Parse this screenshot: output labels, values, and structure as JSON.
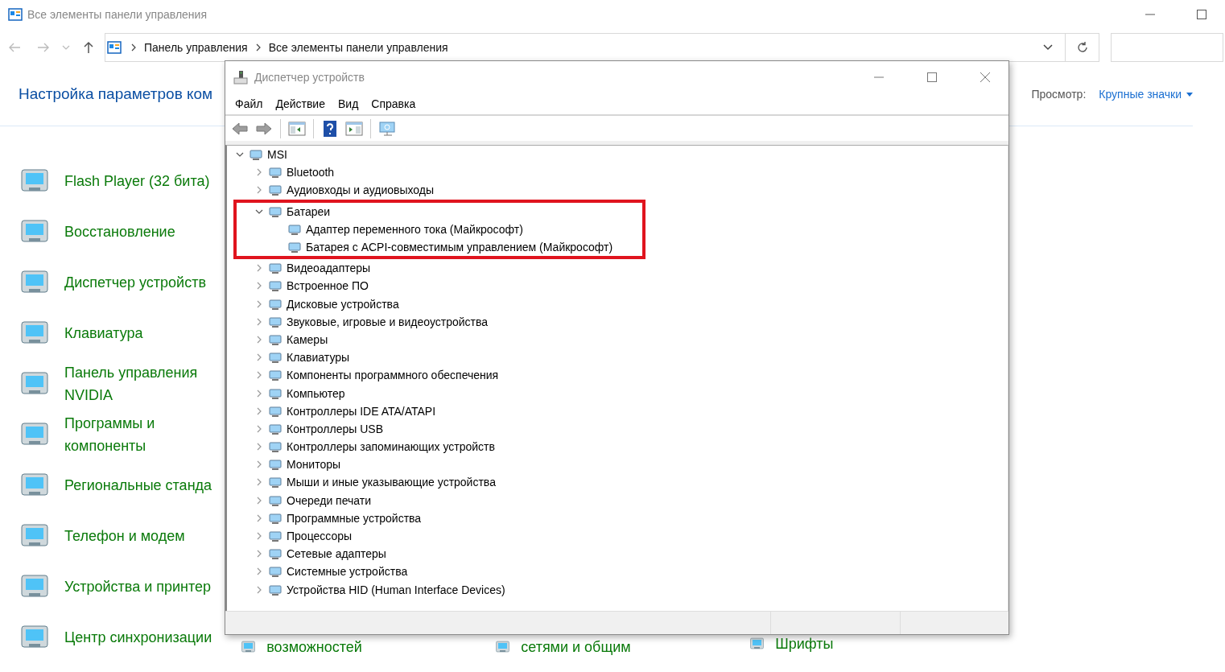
{
  "window": {
    "title": "Все элементы панели управления"
  },
  "address_bar": {
    "breadcrumbs": [
      "Панель управления",
      "Все элементы панели управления"
    ]
  },
  "heading": "Настройка параметров ком",
  "view": {
    "label": "Просмотр:",
    "value": "Крупные значки"
  },
  "applets": [
    {
      "label": "Flash Player (32 бита)"
    },
    {
      "label": "Восстановление"
    },
    {
      "label": "Диспетчер устройств"
    },
    {
      "label": "Клавиатура"
    },
    {
      "label": "Панель управления NVIDIA"
    },
    {
      "label": "Программы и компоненты"
    },
    {
      "label": "Региональные станда"
    },
    {
      "label": "Телефон и модем"
    },
    {
      "label": "Устройства и принтер"
    },
    {
      "label": "Центр синхронизации"
    }
  ],
  "bottom_applets": [
    {
      "label": "возможностей"
    },
    {
      "label": "сетями и общим"
    },
    {
      "label": "Шрифты"
    }
  ],
  "device_manager": {
    "title": "Диспетчер устройств",
    "menu": [
      "Файл",
      "Действие",
      "Вид",
      "Справка"
    ],
    "tree": [
      {
        "label": "MSI",
        "expanded": true,
        "highlighted": false,
        "children": [
          {
            "label": "Bluetooth",
            "expanded": false,
            "highlighted": false
          },
          {
            "label": "Аудиовходы и аудиовыходы",
            "expanded": false,
            "highlighted": false
          },
          {
            "label": "Батареи",
            "expanded": true,
            "highlighted": true,
            "children": [
              {
                "label": "Адаптер переменного тока (Майкрософт)",
                "highlighted": false
              },
              {
                "label": "Батарея с ACPI-совместимым управлением (Майкрософт)",
                "highlighted": false
              }
            ]
          },
          {
            "label": "Видеоадаптеры",
            "expanded": false,
            "highlighted": false
          },
          {
            "label": "Встроенное ПО",
            "expanded": false,
            "highlighted": false
          },
          {
            "label": "Дисковые устройства",
            "expanded": false,
            "highlighted": false
          },
          {
            "label": "Звуковые, игровые и видеоустройства",
            "expanded": false,
            "highlighted": false
          },
          {
            "label": "Камеры",
            "expanded": false,
            "highlighted": false
          },
          {
            "label": "Клавиатуры",
            "expanded": false,
            "highlighted": false
          },
          {
            "label": "Компоненты программного обеспечения",
            "expanded": false,
            "highlighted": false
          },
          {
            "label": "Компьютер",
            "expanded": false,
            "highlighted": false
          },
          {
            "label": "Контроллеры IDE ATA/ATAPI",
            "expanded": false,
            "highlighted": false
          },
          {
            "label": "Контроллеры USB",
            "expanded": false,
            "highlighted": false
          },
          {
            "label": "Контроллеры запоминающих устройств",
            "expanded": false,
            "highlighted": false
          },
          {
            "label": "Мониторы",
            "expanded": false,
            "highlighted": false
          },
          {
            "label": "Мыши и иные указывающие устройства",
            "expanded": false,
            "highlighted": false
          },
          {
            "label": "Очереди печати",
            "expanded": false,
            "highlighted": false
          },
          {
            "label": "Программные устройства",
            "expanded": false,
            "highlighted": false
          },
          {
            "label": "Процессоры",
            "expanded": false,
            "highlighted": false
          },
          {
            "label": "Сетевые адаптеры",
            "expanded": false,
            "highlighted": false
          },
          {
            "label": "Системные устройства",
            "expanded": false,
            "highlighted": false
          },
          {
            "label": "Устройства HID (Human Interface Devices)",
            "expanded": false,
            "highlighted": false
          }
        ]
      }
    ]
  }
}
